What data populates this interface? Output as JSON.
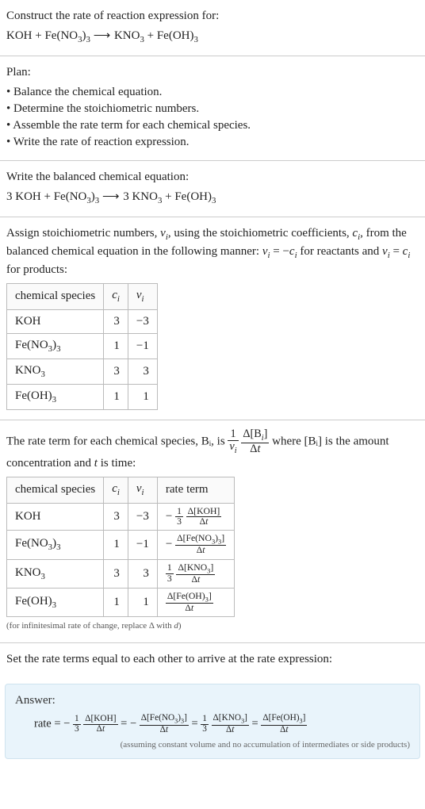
{
  "intro": {
    "heading": "Construct the rate of reaction expression for:",
    "equation": "KOH + Fe(NO₃)₃ ⟶ KNO₃ + Fe(OH)₃"
  },
  "plan": {
    "heading": "Plan:",
    "items": [
      "Balance the chemical equation.",
      "Determine the stoichiometric numbers.",
      "Assemble the rate term for each chemical species.",
      "Write the rate of reaction expression."
    ]
  },
  "balanced": {
    "heading": "Write the balanced chemical equation:",
    "equation": "3 KOH + Fe(NO₃)₃ ⟶ 3 KNO₃ + Fe(OH)₃"
  },
  "stoich_assign": {
    "text": "Assign stoichiometric numbers, νᵢ, using the stoichiometric coefficients, cᵢ, from the balanced chemical equation in the following manner: νᵢ = −cᵢ for reactants and νᵢ = cᵢ for products:",
    "headers": [
      "chemical species",
      "cᵢ",
      "νᵢ"
    ],
    "rows": [
      {
        "species": "KOH",
        "c": "3",
        "nu": "−3"
      },
      {
        "species": "Fe(NO₃)₃",
        "c": "1",
        "nu": "−1"
      },
      {
        "species": "KNO₃",
        "c": "3",
        "nu": "3"
      },
      {
        "species": "Fe(OH)₃",
        "c": "1",
        "nu": "1"
      }
    ]
  },
  "rate_term_intro": {
    "prefix": "The rate term for each chemical species, Bᵢ, is ",
    "mid": " where [Bᵢ] is the amount concentration and ",
    "time_var": "t",
    "suffix": " is time:",
    "frac_outer_num": "1",
    "frac_outer_den": "νᵢ",
    "frac_inner_num": "Δ[Bᵢ]",
    "frac_inner_den": "Δt"
  },
  "rate_table": {
    "headers": [
      "chemical species",
      "cᵢ",
      "νᵢ",
      "rate term"
    ],
    "rows": [
      {
        "species": "KOH",
        "c": "3",
        "nu": "−3",
        "sign": "−",
        "coef_num": "1",
        "coef_den": "3",
        "dnum": "Δ[KOH]",
        "dden": "Δt"
      },
      {
        "species": "Fe(NO₃)₃",
        "c": "1",
        "nu": "−1",
        "sign": "−",
        "coef_num": "",
        "coef_den": "",
        "dnum": "Δ[Fe(NO₃)₃]",
        "dden": "Δt"
      },
      {
        "species": "KNO₃",
        "c": "3",
        "nu": "3",
        "sign": "",
        "coef_num": "1",
        "coef_den": "3",
        "dnum": "Δ[KNO₃]",
        "dden": "Δt"
      },
      {
        "species": "Fe(OH)₃",
        "c": "1",
        "nu": "1",
        "sign": "",
        "coef_num": "",
        "coef_den": "",
        "dnum": "Δ[Fe(OH)₃]",
        "dden": "Δt"
      }
    ],
    "footnote": "(for infinitesimal rate of change, replace Δ with d)"
  },
  "final": {
    "heading": "Set the rate terms equal to each other to arrive at the rate expression:"
  },
  "answer": {
    "label": "Answer:",
    "rate_prefix": "rate = ",
    "terms": [
      {
        "sign": "−",
        "coef_num": "1",
        "coef_den": "3",
        "dnum": "Δ[KOH]",
        "dden": "Δt"
      },
      {
        "sign": "−",
        "coef_num": "",
        "coef_den": "",
        "dnum": "Δ[Fe(NO₃)₃]",
        "dden": "Δt"
      },
      {
        "sign": "",
        "coef_num": "1",
        "coef_den": "3",
        "dnum": "Δ[KNO₃]",
        "dden": "Δt"
      },
      {
        "sign": "",
        "coef_num": "",
        "coef_den": "",
        "dnum": "Δ[Fe(OH)₃]",
        "dden": "Δt"
      }
    ],
    "eq": " = ",
    "assumption": "(assuming constant volume and no accumulation of intermediates or side products)"
  },
  "chem": {
    "KOH": "KOH",
    "FeNO33": "Fe(NO",
    "FeNO33_sub1": "3",
    "FeNO33_mid": ")",
    "FeNO33_sub2": "3",
    "KNO3": "KNO",
    "KNO3_sub": "3",
    "FeOH3": "Fe(OH)",
    "FeOH3_sub": "3",
    "three": "3",
    "arrow": "⟶",
    "plus": " + "
  }
}
